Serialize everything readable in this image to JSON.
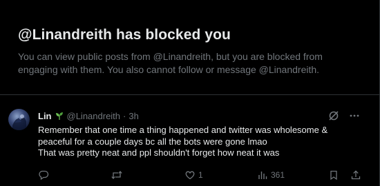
{
  "block_notice": {
    "title": "@Linandreith has blocked you",
    "description": "You can view public posts from @Linandreith, but you are blocked from engaging with them. You also cannot follow or message @Linandreith."
  },
  "tweet": {
    "display_name": "Lin",
    "handle": "@Linandreith",
    "separator": "·",
    "time": "3h",
    "text_lines": [
      "Remember that one time a thing happened and twitter was wholesome &",
      "peaceful for a couple days bc all the bots were gone lmao",
      "That was pretty neat and ppl shouldn't forget how neat it was"
    ],
    "actions": {
      "reply_count": "",
      "repost_count": "",
      "like_count": "1",
      "view_count": "361"
    }
  },
  "icons": {
    "header": [
      "grok-icon",
      "more-icon"
    ],
    "actions": [
      "reply-icon",
      "repost-icon",
      "like-icon",
      "views-icon",
      "bookmark-icon",
      "share-icon"
    ]
  },
  "colors": {
    "background": "#000000",
    "text_primary": "#e7e9ea",
    "text_secondary": "#71767b",
    "divider": "#2f3336"
  }
}
